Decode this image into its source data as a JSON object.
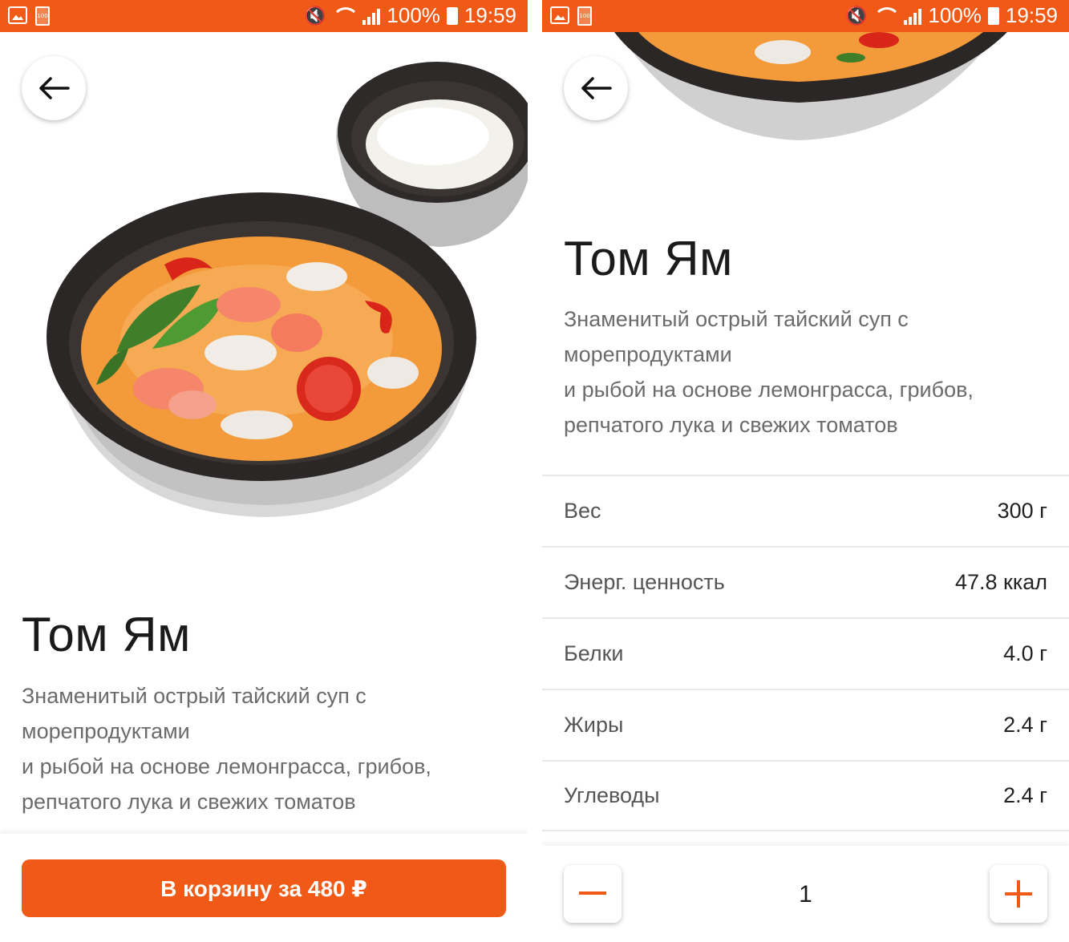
{
  "status_bar": {
    "battery_small": "100",
    "battery_percent": "100%",
    "time": "19:59"
  },
  "product": {
    "name": "Том Ям",
    "description_line1": "Знаменитый острый тайский суп с",
    "description_line2": "морепродуктами",
    "description_line3": "и рыбой на основе лемонграсса, грибов,",
    "description_line4": "репчатого лука и свежих томатов"
  },
  "order_button": {
    "label": "В корзину за 480 ₽"
  },
  "nutrition": [
    {
      "label": "Вес",
      "value": "300 г"
    },
    {
      "label": "Энерг. ценность",
      "value": "47.8 ккал"
    },
    {
      "label": "Белки",
      "value": "4.0 г"
    },
    {
      "label": "Жиры",
      "value": "2.4 г"
    },
    {
      "label": "Углеводы",
      "value": "2.4 г"
    }
  ],
  "quantity": {
    "value": "1",
    "minus_icon": "minus-icon",
    "plus_icon": "plus-icon"
  },
  "colors": {
    "accent": "#f05a16",
    "soup": "#f39a3a",
    "bowl": "#2b2726"
  }
}
